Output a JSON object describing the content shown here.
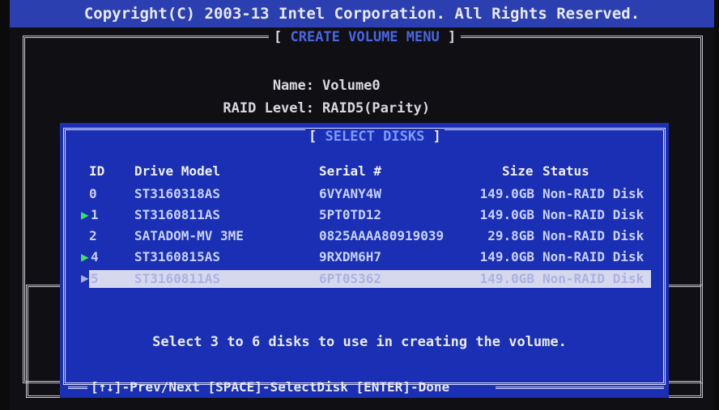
{
  "header": {
    "copyright": "Copyright(C) 2003-13 Intel Corporation.  All Rights Reserved."
  },
  "create_menu": {
    "title": "CREATE VOLUME MENU",
    "name_label": "Name:",
    "name_value": "Volume0",
    "raid_label": "RAID Level:",
    "raid_value": "RAID5(Parity)"
  },
  "select_disks": {
    "title": "SELECT DISKS",
    "columns": {
      "id": "ID",
      "model": "Drive Model",
      "serial": "Serial #",
      "size": "Size",
      "status": "Status"
    },
    "rows": [
      {
        "id": "0",
        "selected_marker": "",
        "model": "ST3160318AS",
        "serial": "6VYANY4W",
        "size": "149.0GB",
        "status": "Non-RAID Disk"
      },
      {
        "id": "1",
        "selected_marker": "▶",
        "model": "ST3160811AS",
        "serial": "5PT0TD12",
        "size": "149.0GB",
        "status": "Non-RAID Disk"
      },
      {
        "id": "2",
        "selected_marker": "",
        "model": "SATADOM-MV 3ME",
        "serial": "0825AAAA80919039",
        "size": "29.8GB",
        "status": "Non-RAID Disk"
      },
      {
        "id": "4",
        "selected_marker": "▶",
        "model": "ST3160815AS",
        "serial": "9RXDM6H7",
        "size": "149.0GB",
        "status": "Non-RAID Disk"
      },
      {
        "id": "5",
        "selected_marker": "▶",
        "model": "ST3160811AS",
        "serial": "6PT0S362",
        "size": "149.0GB",
        "status": "Non-RAID Disk",
        "highlighted": true
      }
    ],
    "message": "Select 3 to 6 disks to use in creating the volume.",
    "help": "[↑↓]-Prev/Next [SPACE]-SelectDisk [ENTER]-Done"
  },
  "colors": {
    "dialog_bg": "#1a2fb4",
    "topbar_bg": "#2c3fb0",
    "selected_marker": "#3fe06a",
    "highlight_row": "#d6d9ee"
  }
}
